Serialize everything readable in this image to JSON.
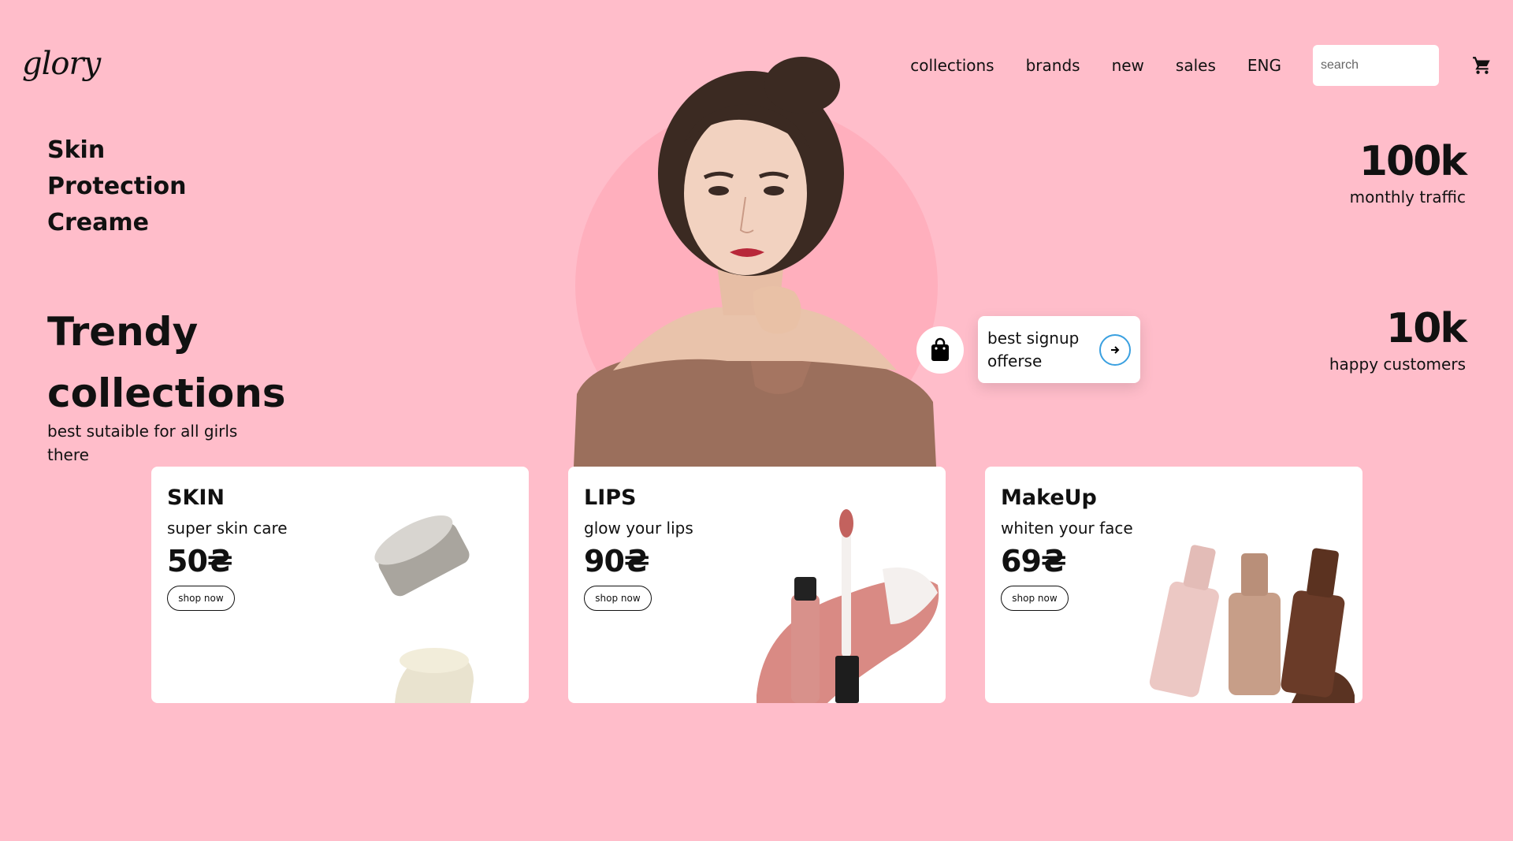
{
  "brand": {
    "logo": "glory"
  },
  "nav": {
    "links": [
      "collections",
      "brands",
      "new",
      "sales",
      "ENG"
    ],
    "search_placeholder": "search",
    "cart_icon": "cart-icon"
  },
  "hero": {
    "skin_title": [
      "Skin",
      "Protection",
      "Creame"
    ],
    "trendy_title": [
      "Trendy",
      "collections"
    ],
    "trendy_sub": "best sutaible for all girls there"
  },
  "stats": [
    {
      "value": "100k",
      "label": "monthly traffic"
    },
    {
      "value": "10k",
      "label": "happy customers"
    }
  ],
  "offer": {
    "text": "best signup offerse",
    "icon": "shopping-bag-icon"
  },
  "cards": [
    {
      "title": "SKIN",
      "subtitle": "super skin care",
      "price": "50₴",
      "button": "shop now"
    },
    {
      "title": "LIPS",
      "subtitle": "glow your lips",
      "price": "90₴",
      "button": "shop now"
    },
    {
      "title": "MakeUp",
      "subtitle": "whiten your face",
      "price": "69₴",
      "button": "shop now"
    }
  ],
  "colors": {
    "background": "#ffbdca",
    "card": "#ffffff",
    "accent": "#3aa0e0"
  }
}
